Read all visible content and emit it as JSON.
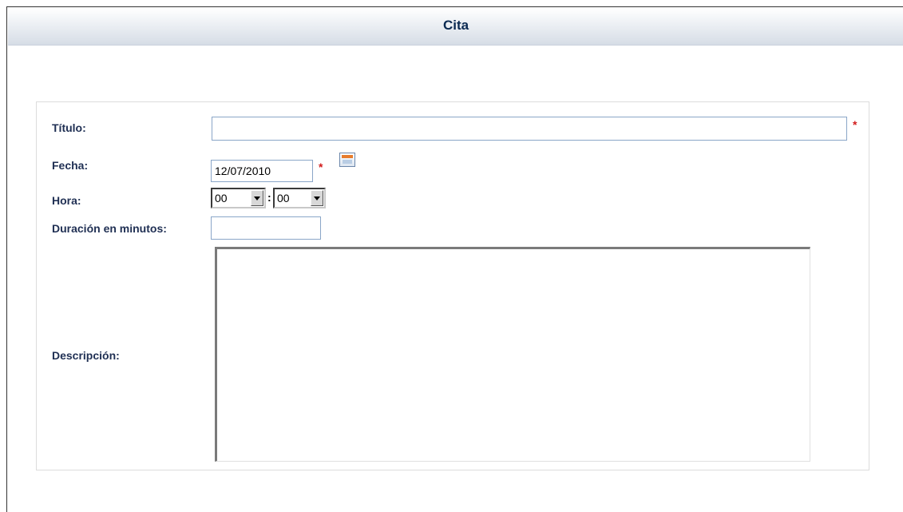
{
  "header": {
    "title": "Cita"
  },
  "form": {
    "titulo": {
      "label": "Título:",
      "value": ""
    },
    "fecha": {
      "label": "Fecha:",
      "value": "12/07/2010"
    },
    "hora": {
      "label": "Hora:",
      "hour": "00",
      "minute": "00",
      "separator": ":"
    },
    "duracion": {
      "label": "Duración en minutos:",
      "value": ""
    },
    "descripcion": {
      "label": "Descripción:",
      "value": ""
    },
    "required_marker": "*"
  },
  "icons": {
    "calendar": "calendar-icon",
    "dropdown": "chevron-down-icon"
  },
  "colors": {
    "label": "#1f2f53",
    "required": "#d21c1c",
    "input_border": "#8aa6c8",
    "title": "#0b2a52"
  }
}
